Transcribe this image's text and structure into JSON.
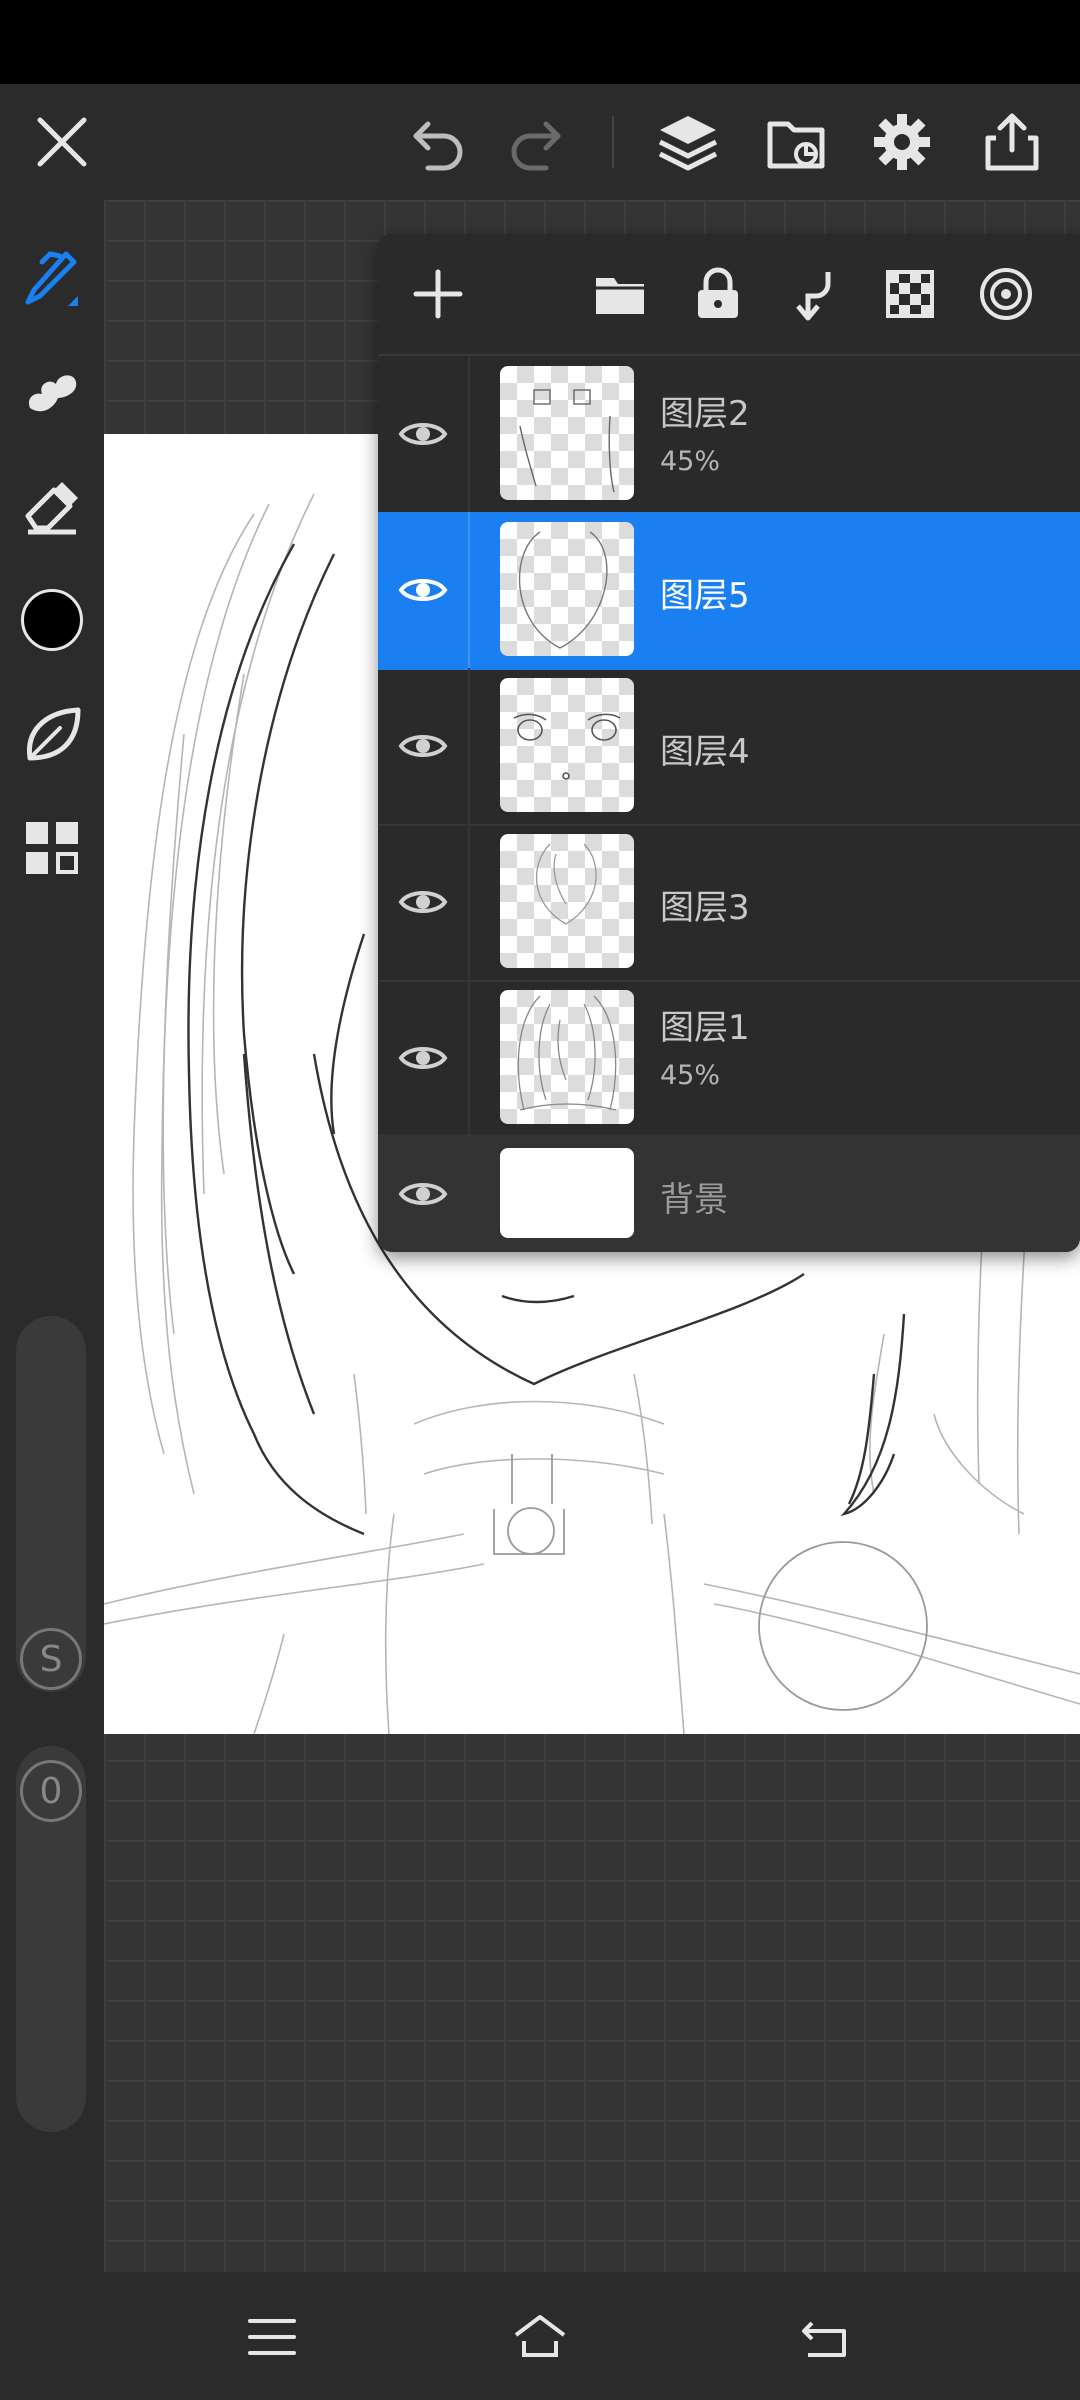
{
  "toolbar": {
    "icons": [
      "close-icon",
      "undo-icon",
      "redo-icon",
      "layers-icon",
      "import-icon",
      "settings-icon",
      "share-icon"
    ]
  },
  "left_tools": {
    "icons": [
      "pen-icon",
      "smudge-icon",
      "eraser-icon",
      "color-swatch",
      "leaf-icon",
      "grid-icon"
    ],
    "active_color": "#000000",
    "accent_color": "#1a7ff0",
    "slider_top_badge": "S",
    "slider_bottom_badge": "0"
  },
  "layers_panel": {
    "toolbar_icons": [
      "add-icon",
      "folder-icon",
      "lock-icon",
      "merge-down-icon",
      "transparency-icon",
      "blend-icon"
    ],
    "layers": [
      {
        "name": "图层2",
        "opacity": "45%",
        "visible": true,
        "selected": false
      },
      {
        "name": "图层5",
        "opacity": "",
        "visible": true,
        "selected": true
      },
      {
        "name": "图层4",
        "opacity": "",
        "visible": true,
        "selected": false
      },
      {
        "name": "图层3",
        "opacity": "",
        "visible": true,
        "selected": false
      },
      {
        "name": "图层1",
        "opacity": "45%",
        "visible": true,
        "selected": false
      },
      {
        "name": "背景",
        "opacity": "",
        "visible": true,
        "selected": false
      }
    ]
  },
  "nav": {
    "icons": [
      "menu-icon",
      "home-icon",
      "back-icon"
    ]
  }
}
